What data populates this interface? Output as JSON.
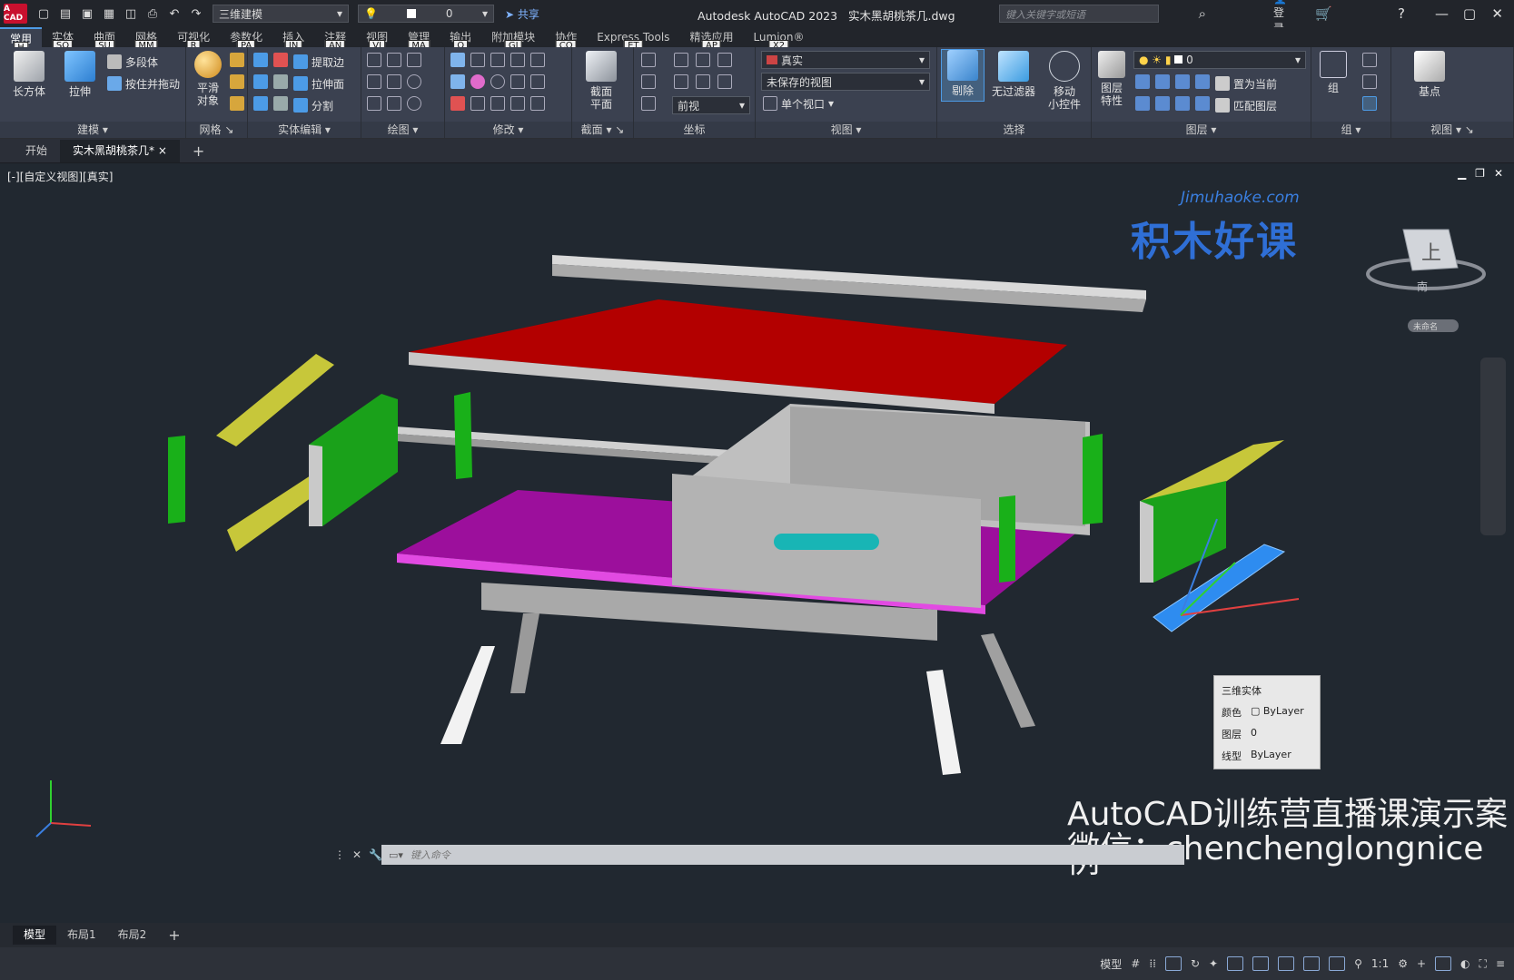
{
  "app": {
    "logo": "A CAD",
    "title": "Autodesk AutoCAD 2023",
    "filename": "实木黑胡桃茶几.dwg"
  },
  "qat": {
    "workspace": "三维建模",
    "layer": "0",
    "share": "共享"
  },
  "search": {
    "placeholder": "键入关键字或短语"
  },
  "user": {
    "login": "登录"
  },
  "ribbon_tabs": [
    {
      "label": "常用",
      "key": "H"
    },
    {
      "label": "实体",
      "key": "SO"
    },
    {
      "label": "曲面",
      "key": "SU"
    },
    {
      "label": "网格",
      "key": "MM"
    },
    {
      "label": "可视化",
      "key": "R"
    },
    {
      "label": "参数化",
      "key": "PA"
    },
    {
      "label": "插入",
      "key": "IN"
    },
    {
      "label": "注释",
      "key": "AN"
    },
    {
      "label": "视图",
      "key": "VI"
    },
    {
      "label": "管理",
      "key": "MA"
    },
    {
      "label": "输出",
      "key": "O"
    },
    {
      "label": "附加模块",
      "key": "GI"
    },
    {
      "label": "协作",
      "key": "CO"
    },
    {
      "label": "Express Tools",
      "key": "ET"
    },
    {
      "label": "精选应用",
      "key": "AP"
    },
    {
      "label": "Lumion®",
      "key": "X2"
    }
  ],
  "panels": {
    "model": {
      "title": "建模",
      "box": "长方体",
      "extrude": "拉伸",
      "polysolid": "多段体",
      "presspull": "按住并拖动"
    },
    "mesh": {
      "title": "网格",
      "smooth": "平滑\n对象"
    },
    "solidedit": {
      "title": "实体编辑",
      "extract": "提取边",
      "extrudeface": "拉伸面",
      "slice": "分割"
    },
    "draw": {
      "title": "绘图"
    },
    "modify": {
      "title": "修改"
    },
    "section": {
      "title": "截面",
      "plane": "截面\n平面"
    },
    "coords": {
      "title": "坐标",
      "view": "前视"
    },
    "view": {
      "title": "视图",
      "style": "真实",
      "saved": "未保存的视图",
      "vport": "单个视口"
    },
    "select": {
      "title": "选择",
      "cull": "剔除",
      "nofilter": "无过滤器",
      "gizmo": "移动\n小控件"
    },
    "layers": {
      "title": "图层",
      "props": "图层\n特性",
      "layer": "0",
      "setcurrent": "置为当前",
      "match": "匹配图层"
    },
    "groups": {
      "title": "组",
      "group": "组"
    },
    "views": {
      "title": "视图",
      "base": "基点"
    }
  },
  "doc_tabs": {
    "start": "开始",
    "file": "实木黑胡桃茶几*"
  },
  "viewport": {
    "label": "[-][自定义视图][真实]",
    "watermark_url": "Jimuhaoke.com",
    "watermark_cn": "积木好课",
    "cube_face": "上",
    "cube_south": "南",
    "wcs": "未命名"
  },
  "overlay": {
    "line1": "AutoCAD训练营直播课演示案例",
    "line2": "微信：chenchenglongnice"
  },
  "props_popup": {
    "title": "三维实体",
    "color_label": "颜色",
    "color": "ByLayer",
    "layer_label": "图层",
    "layer": "0",
    "linetype_label": "线型",
    "linetype": "ByLayer"
  },
  "command": {
    "placeholder": "键入命令"
  },
  "layout_tabs": [
    "模型",
    "布局1",
    "布局2"
  ],
  "status": {
    "model": "模型",
    "scale": "1:1"
  }
}
